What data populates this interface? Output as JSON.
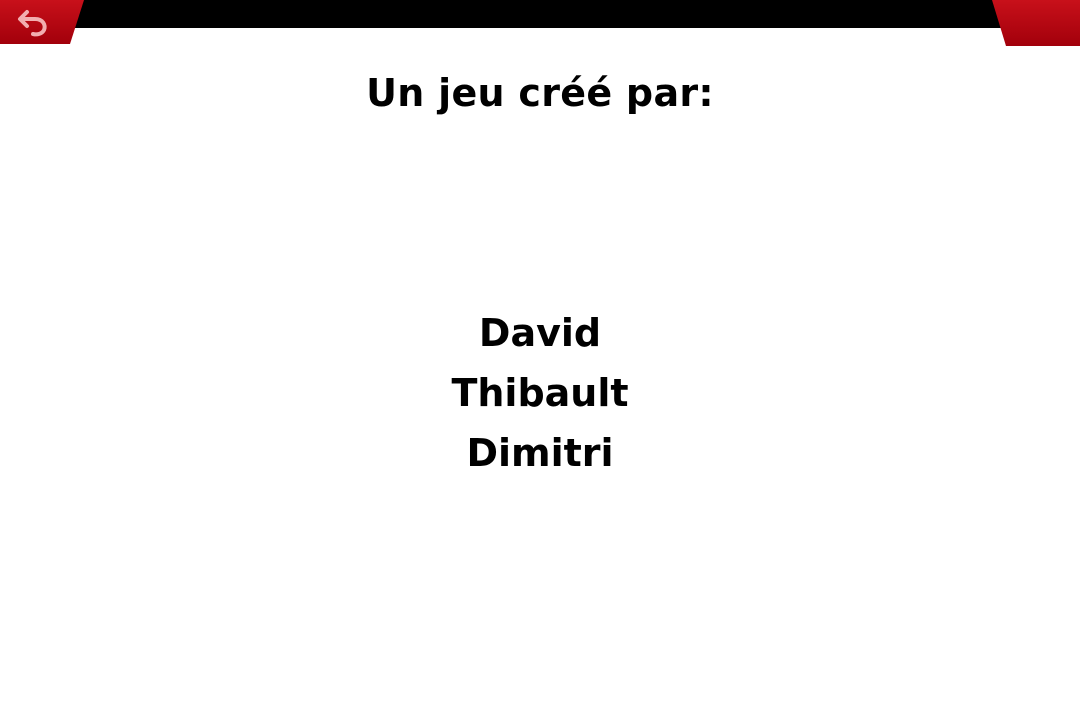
{
  "colors": {
    "top_bar": "#000000",
    "tab_red": "#b0000d",
    "tab_red_light": "#d41a22",
    "icon": "#f2aeb0",
    "background": "#ffffff",
    "text": "#000000"
  },
  "back_button": {
    "icon": "back-arrow-icon"
  },
  "credits": {
    "heading": "Un jeu créé par:",
    "names": [
      "David",
      "Thibault",
      "Dimitri"
    ]
  }
}
